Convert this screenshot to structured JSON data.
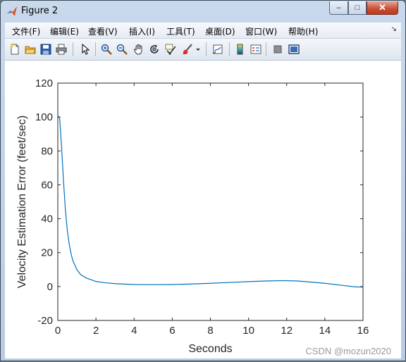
{
  "window": {
    "title": "Figure 2"
  },
  "window_buttons": {
    "minimize": "–",
    "maximize": "□",
    "close": "✕"
  },
  "menu": {
    "items": [
      "文件(F)",
      "编辑(E)",
      "查看(V)",
      "插入(I)",
      "工具(T)",
      "桌面(D)",
      "窗口(W)",
      "帮助(H)"
    ],
    "grip": "↘"
  },
  "toolbar": {
    "icons": [
      "new-figure-icon",
      "open-file-icon",
      "save-icon",
      "print-icon",
      "edit-plot-arrow-icon",
      "zoom-in-icon",
      "zoom-out-icon",
      "pan-hand-icon",
      "rotate-3d-icon",
      "data-cursor-icon",
      "brush-icon",
      "brush-dropdown-icon",
      "link-plot-icon",
      "colorbar-icon",
      "legend-icon",
      "hide-plot-tools-icon",
      "show-plot-tools-icon"
    ]
  },
  "watermark": "CSDN @mozun2020",
  "chart_data": {
    "type": "line",
    "xlabel": "Seconds",
    "ylabel": "Velocity Estimation Error (feet/sec)",
    "xlim": [
      0,
      16
    ],
    "ylim": [
      -20,
      120
    ],
    "xticks": [
      "0",
      "2",
      "4",
      "6",
      "8",
      "10",
      "12",
      "14",
      "16"
    ],
    "yticks": [
      "-20",
      "0",
      "20",
      "40",
      "60",
      "80",
      "100",
      "120"
    ],
    "grid": false,
    "color": "#0072BD",
    "series": [
      {
        "x": [
          0,
          0.1,
          0.2,
          0.3,
          0.4,
          0.5,
          0.6,
          0.7,
          0.8,
          1.0,
          1.2,
          1.5,
          2.0,
          2.5,
          3.0,
          4.0,
          5.0,
          6.0,
          7.0,
          8.0,
          9.0,
          10.0,
          11.0,
          11.8,
          12.5,
          13.0,
          14.0,
          15.0,
          15.5,
          16.0
        ],
        "y": [
          101,
          99,
          82,
          62,
          45,
          33,
          25,
          19,
          15,
          10,
          7,
          5,
          3,
          2.2,
          1.7,
          1.2,
          1.1,
          1.2,
          1.5,
          1.9,
          2.4,
          2.9,
          3.3,
          3.5,
          3.3,
          2.9,
          1.9,
          0.6,
          -0.1,
          -0.4
        ]
      }
    ]
  }
}
